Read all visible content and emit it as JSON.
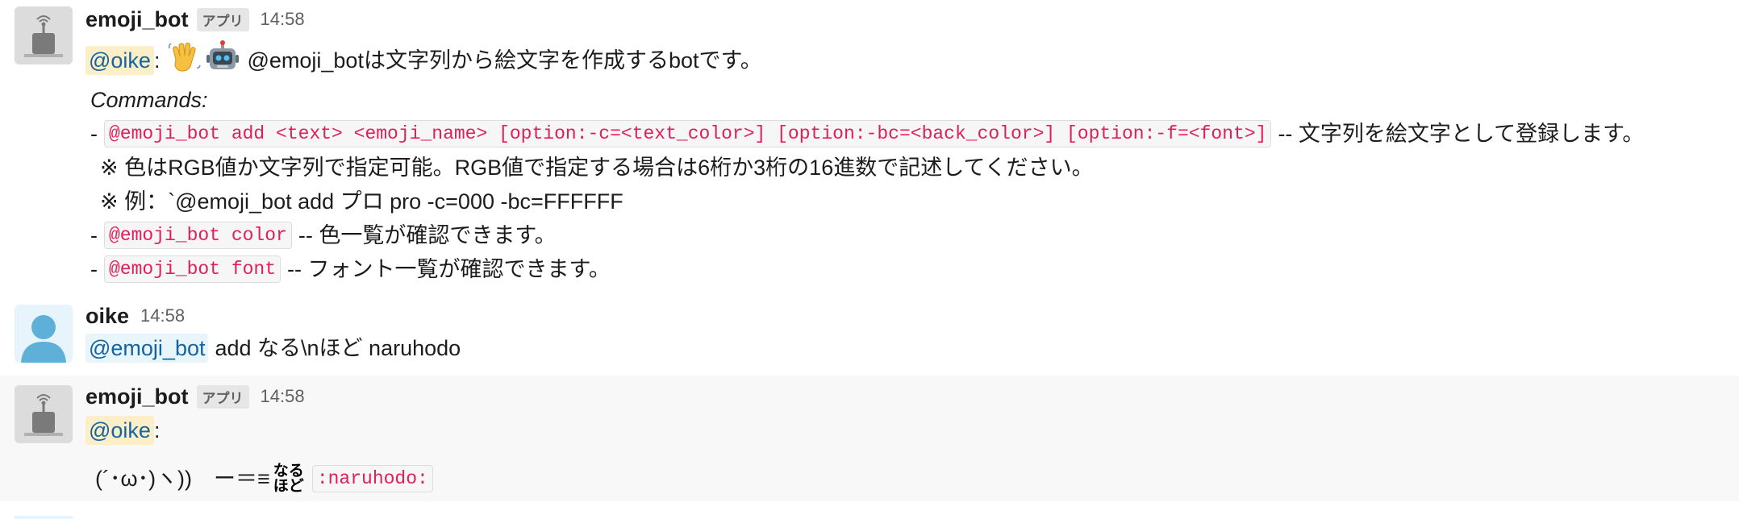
{
  "messages": [
    {
      "author": "emoji_bot",
      "badge": "アプリ",
      "time": "14:58",
      "mention": "@oike",
      "colon": ":",
      "intro": "@emoji_botは文字列から絵文字を作成するbotです。",
      "commands_label": "Commands:",
      "dash": "-",
      "cmd_add": "@emoji_bot add <text> <emoji_name> [option:-c=<text_color>] [option:-bc=<back_color>] [option:-f=<font>]",
      "cmd_add_desc": "-- 文字列を絵文字として登録します。",
      "note1": "※ 色はRGB値か文字列で指定可能。RGB値で指定する場合は6桁か3桁の16進数で記述してください。",
      "note2": "※ 例：`@emoji_bot add プロ pro -c=000 -bc=FFFFFF",
      "cmd_color": "@emoji_bot color",
      "cmd_color_desc": "-- 色一覧が確認できます。",
      "cmd_font": "@emoji_bot font",
      "cmd_font_desc": "-- フォント一覧が確認できます。"
    },
    {
      "author": "oike",
      "time": "14:58",
      "mention": "@emoji_bot",
      "text": "add なる\\nほど naruhodo"
    },
    {
      "author": "emoji_bot",
      "badge": "アプリ",
      "time": "14:58",
      "mention": "@oike",
      "colon": ":",
      "kaomoji": "(´･ω･)ヽ))　ー＝≡",
      "emoji_top": "なる",
      "emoji_bottom": "ほど",
      "shortcode": ":naruhodo:"
    }
  ],
  "icons": [
    "robot-avatar-icon",
    "person-avatar-icon",
    "waving-hand-emoji",
    "robot-face-emoji"
  ]
}
